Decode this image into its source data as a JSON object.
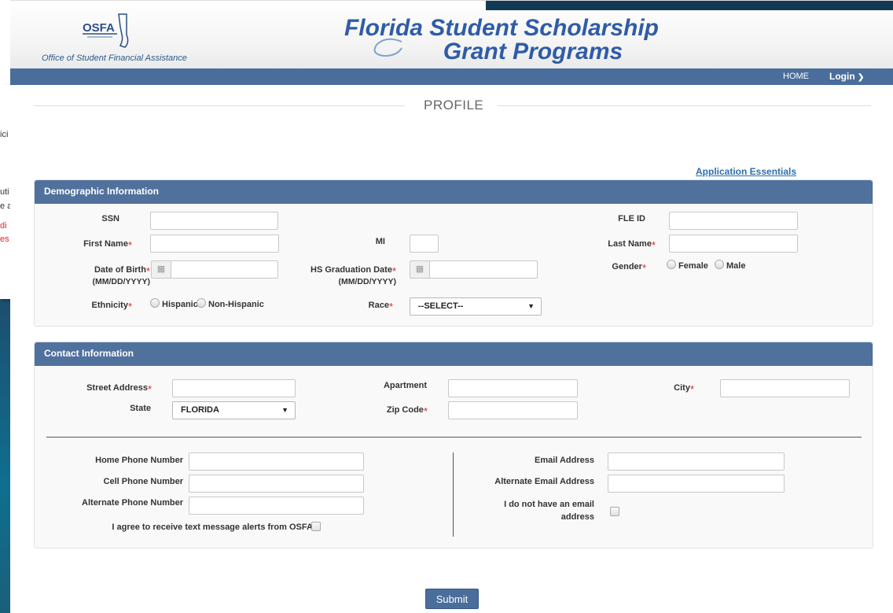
{
  "header": {
    "logo_text": "OSFA",
    "org_name": "Office of Student Financial Assistance",
    "title_line1": "Florida Student Scholarship",
    "title_line2": "Grant Programs"
  },
  "nav": {
    "home": "HOME",
    "login": "Login"
  },
  "behind_window": {
    "lines": [
      "ici",
      "uti",
      "e a",
      "di",
      "es"
    ]
  },
  "page": {
    "title": "PROFILE",
    "app_essentials": "Application Essentials"
  },
  "demographic": {
    "heading": "Demographic Information",
    "ssn_label": "SSN",
    "fle_id_label": "FLE ID",
    "first_name_label": "First Name",
    "mi_label": "MI",
    "last_name_label": "Last Name",
    "dob_label": "Date of Birth",
    "dob_format": "(MM/DD/YYYY)",
    "hs_grad_label": "HS Graduation Date",
    "hs_grad_format": "(MM/DD/YYYY)",
    "gender_label": "Gender",
    "gender_options": [
      "Female",
      "Male"
    ],
    "ethnicity_label": "Ethnicity",
    "ethnicity_options": [
      "Hispanic",
      "Non-Hispanic"
    ],
    "race_label": "Race",
    "race_value": "--SELECT--"
  },
  "contact": {
    "heading": "Contact Information",
    "street_label": "Street Address",
    "apartment_label": "Apartment",
    "city_label": "City",
    "state_label": "State",
    "state_value": "FLORIDA",
    "zip_label": "Zip Code",
    "home_phone_label": "Home Phone Number",
    "cell_phone_label": "Cell Phone Number",
    "alt_phone_label": "Alternate Phone Number",
    "text_alerts_label": "I agree to receive text message alerts from OSFA.",
    "email_label": "Email Address",
    "alt_email_label": "Alternate Email Address",
    "no_email_label_1": "I do not have an email",
    "no_email_label_2": "address"
  },
  "submit_label": "Submit",
  "colors": {
    "nav": "#4a6e9b",
    "section_head": "#51719d",
    "required": "#e21f26",
    "link": "#2e6fad"
  }
}
